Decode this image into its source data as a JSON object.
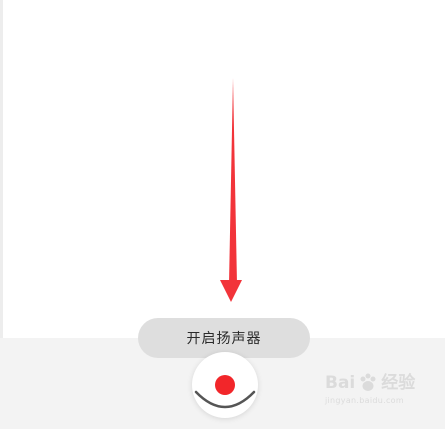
{
  "speaker_button": {
    "label": "开启扬声器"
  },
  "record_button": {
    "accent_color": "#f2262a"
  },
  "annotation": {
    "arrow_color": "#f2343a"
  },
  "watermark": {
    "logo_text": "Bai",
    "logo_suffix": "经验",
    "url": "jingyan.baidu.com"
  },
  "icons": {
    "record": "record-dot-icon",
    "collapse": "chevron-down-icon",
    "watermark_paw": "baidu-paw-icon"
  }
}
